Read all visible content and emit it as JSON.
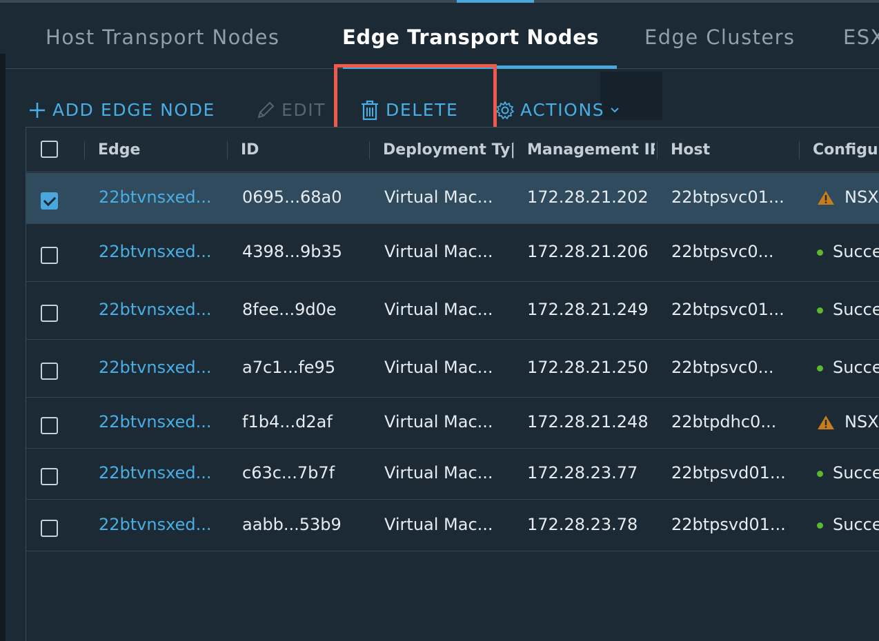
{
  "tabs": [
    {
      "label": "Host Transport Nodes",
      "active": false
    },
    {
      "label": "Edge Transport Nodes",
      "active": true
    },
    {
      "label": "Edge Clusters",
      "active": false
    },
    {
      "label": "ESX",
      "active": false
    }
  ],
  "toolbar": {
    "add_label": "ADD EDGE NODE",
    "edit_label": "EDIT",
    "delete_label": "DELETE",
    "actions_label": "ACTIONS"
  },
  "grid": {
    "columns": [
      "Edge",
      "ID",
      "Deployment Ty|",
      "Management IP",
      "Host",
      "Configu"
    ],
    "rows": [
      {
        "edge": "22btvnsxed...",
        "id": "0695...68a0",
        "deployment": "Virtual Mac...",
        "ip": "172.28.21.202",
        "host": "22btpsvc01...",
        "status": "NSX",
        "status_type": "warning",
        "selected": true
      },
      {
        "edge": "22btvnsxed...",
        "id": "4398...9b35",
        "deployment": "Virtual Mac...",
        "ip": "172.28.21.206",
        "host": "22btpsvc0...",
        "status": "Succe",
        "status_type": "success",
        "selected": false
      },
      {
        "edge": "22btvnsxed...",
        "id": "8fee...9d0e",
        "deployment": "Virtual Mac...",
        "ip": "172.28.21.249",
        "host": "22btpsvc01...",
        "status": "Succe",
        "status_type": "success",
        "selected": false
      },
      {
        "edge": "22btvnsxed...",
        "id": "a7c1...fe95",
        "deployment": "Virtual Mac...",
        "ip": "172.28.21.250",
        "host": "22btpsvc0...",
        "status": "Succe",
        "status_type": "success",
        "selected": false
      },
      {
        "edge": "22btvnsxed...",
        "id": "f1b4...d2af",
        "deployment": "Virtual Mac...",
        "ip": "172.28.21.248",
        "host": "22btpdhc0...",
        "status": "NSX",
        "status_type": "warning",
        "selected": false
      },
      {
        "edge": "22btvnsxed...",
        "id": "c63c...7b7f",
        "deployment": "Virtual Mac...",
        "ip": "172.28.23.77",
        "host": "22btpsvd01...",
        "status": "Succe",
        "status_type": "success",
        "selected": false
      },
      {
        "edge": "22btvnsxed...",
        "id": "aabb...53b9",
        "deployment": "Virtual Mac...",
        "ip": "172.28.23.78",
        "host": "22btpsvd01...",
        "status": "Succe",
        "status_type": "success",
        "selected": false
      }
    ]
  },
  "colors": {
    "accent": "#49aee3",
    "highlight": "#ef5a4d",
    "success": "#5cb82e",
    "warning": "#c77d1b",
    "selected_row": "#314b5e"
  }
}
